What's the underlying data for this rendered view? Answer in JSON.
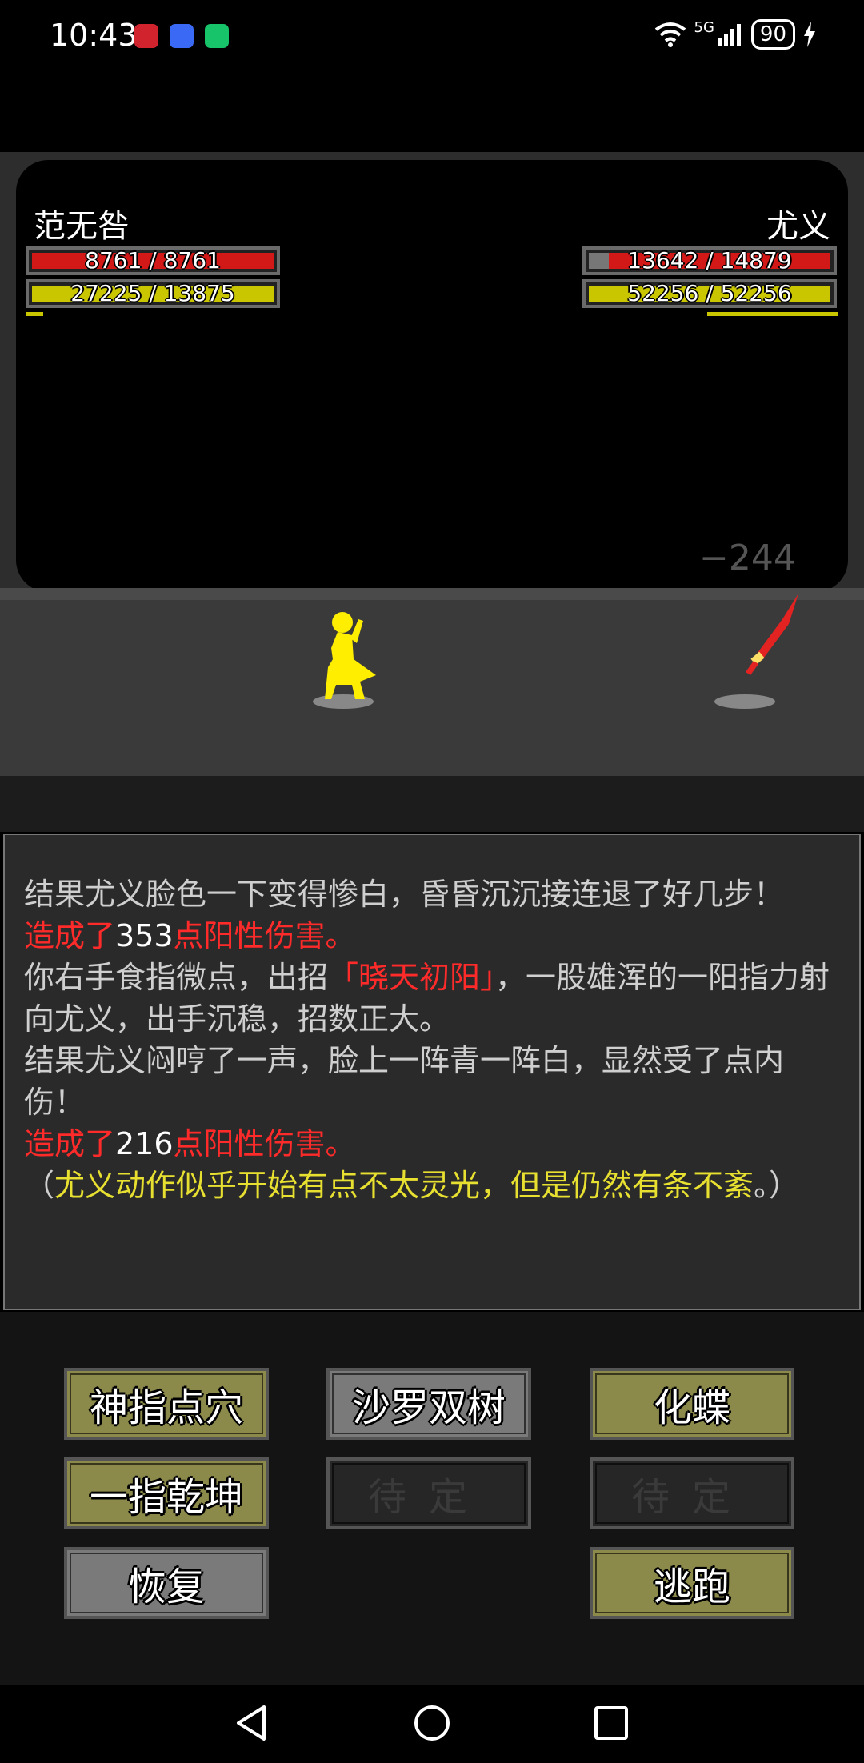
{
  "status_bar": {
    "time": "10:43",
    "network": "5G",
    "battery": "90",
    "app_icons": [
      "huawei-icon",
      "tieba-icon",
      "green-app-icon"
    ],
    "colors": {
      "huawei": "#d0232d",
      "tieba": "#3a6af5",
      "green": "#18c46a"
    }
  },
  "player": {
    "name": "范无咎",
    "hp": "8761 / 8761",
    "mp": "27225 / 13875",
    "hp_fraction": 1.0,
    "mp_fraction": 1.0
  },
  "enemy": {
    "name": "尤义",
    "hp": "13642 / 14879",
    "mp": "52256 / 52256",
    "hp_fraction": 0.917,
    "mp_fraction": 1.0
  },
  "floating_damage": "−244",
  "log": {
    "lines": [
      {
        "segments": [
          {
            "text": "结果尤义脸色一下变得惨白，昏昏沉沉接连退了好几步！",
            "style": "normal"
          }
        ]
      },
      {
        "segments": [
          {
            "text": "造成了",
            "style": "red"
          },
          {
            "text": "353",
            "style": "white"
          },
          {
            "text": "点阳性伤害。",
            "style": "red"
          }
        ]
      },
      {
        "segments": [
          {
            "text": "你右手食指微点，出招",
            "style": "normal"
          },
          {
            "text": "「晓天初阳」",
            "style": "red"
          },
          {
            "text": "，一股雄浑的一阳指力射向尤义，出手沉稳，招数正大。",
            "style": "normal"
          }
        ]
      },
      {
        "segments": [
          {
            "text": "结果尤义闷哼了一声，脸上一阵青一阵白，显然受了点内伤！",
            "style": "normal"
          }
        ]
      },
      {
        "segments": [
          {
            "text": "造成了",
            "style": "red"
          },
          {
            "text": "216",
            "style": "white"
          },
          {
            "text": "点阳性伤害。",
            "style": "red"
          }
        ]
      },
      {
        "segments": [
          {
            "text": "（",
            "style": "normal"
          },
          {
            "text": "尤义动作似乎开始有点不太灵光，但是仍然有条不紊",
            "style": "yellow"
          },
          {
            "text": "。）",
            "style": "normal"
          }
        ]
      }
    ]
  },
  "skills": [
    {
      "label": "神指点穴",
      "style": "olive"
    },
    {
      "label": "沙罗双树",
      "style": "gray"
    },
    {
      "label": "化蝶",
      "style": "olive"
    },
    {
      "label": "一指乾坤",
      "style": "olive"
    },
    {
      "label": "待定",
      "style": "dark"
    },
    {
      "label": "待定",
      "style": "dark"
    },
    {
      "label": "恢复",
      "style": "gray"
    },
    {
      "label": "逃跑",
      "style": "olive"
    }
  ],
  "nav": {
    "back": "back-icon",
    "home": "home-icon",
    "recents": "recents-icon"
  }
}
